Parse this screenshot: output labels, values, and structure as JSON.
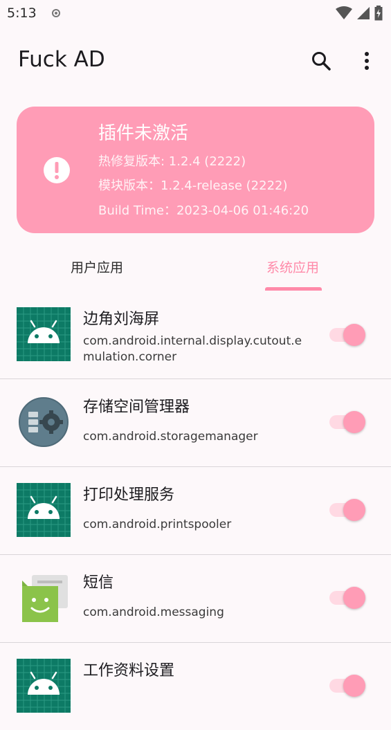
{
  "status_bar": {
    "time": "5:13"
  },
  "app_bar": {
    "title": "Fuck AD"
  },
  "status_card": {
    "title": "插件未激活",
    "hotfix_version": "热修复版本: 1.2.4 (2222)",
    "module_version": "模块版本：1.2.4-release (2222)",
    "build_time": "Build Time：2023-04-06 01:46:20",
    "color": "#ff9cb6"
  },
  "tabs": [
    {
      "label": "用户应用",
      "selected": false
    },
    {
      "label": "系统应用",
      "selected": true
    }
  ],
  "accent_color": "#ff8aa9",
  "apps": [
    {
      "name": "边角刘海屏",
      "package": "com.android.internal.display.cutout.emulation.corner",
      "icon": "android-icon",
      "enabled": true
    },
    {
      "name": "存储空间管理器",
      "package": "com.android.storagemanager",
      "icon": "storage-manager-icon",
      "enabled": true
    },
    {
      "name": "打印处理服务",
      "package": "com.android.printspooler",
      "icon": "android-icon",
      "enabled": true
    },
    {
      "name": "短信",
      "package": "com.android.messaging",
      "icon": "messaging-icon",
      "enabled": true
    },
    {
      "name": "工作资料设置",
      "package": "",
      "icon": "android-icon",
      "enabled": true
    }
  ]
}
